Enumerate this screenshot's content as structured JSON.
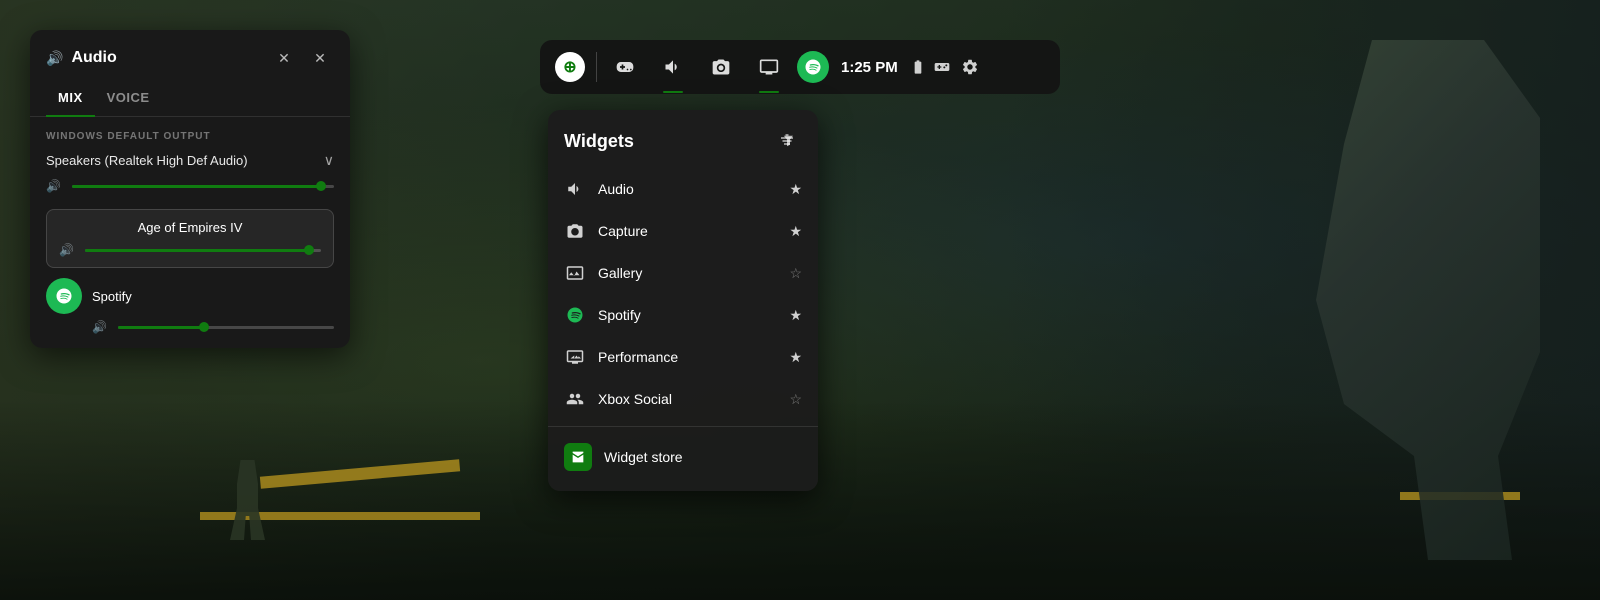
{
  "background": {
    "description": "Game scene - sci-fi military environment"
  },
  "topNav": {
    "time": "1:25 PM",
    "icons": [
      "xbox",
      "gamepad",
      "volume",
      "screenshot",
      "display",
      "spotify",
      "settings"
    ],
    "activeIcons": [
      "volume",
      "display"
    ]
  },
  "audioPanel": {
    "title": "Audio",
    "pinLabel": "✕",
    "closeLabel": "✕",
    "tabs": [
      "MIX",
      "VOICE"
    ],
    "activeTab": "MIX",
    "sectionLabel": "WINDOWS DEFAULT OUTPUT",
    "deviceName": "Speakers (Realtek High Def Audio)",
    "deviceVolume": 95,
    "appItems": [
      {
        "name": "Age of Empires IV",
        "volume": 95
      }
    ],
    "spotifyItem": {
      "name": "Spotify",
      "volume": 40
    }
  },
  "widgetsPanel": {
    "title": "Widgets",
    "items": [
      {
        "name": "Audio",
        "iconType": "volume",
        "starred": true
      },
      {
        "name": "Capture",
        "iconType": "capture",
        "starred": true
      },
      {
        "name": "Gallery",
        "iconType": "gallery",
        "starred": false
      },
      {
        "name": "Spotify",
        "iconType": "spotify",
        "starred": true
      },
      {
        "name": "Performance",
        "iconType": "performance",
        "starred": true
      },
      {
        "name": "Xbox Social",
        "iconType": "social",
        "starred": false
      }
    ],
    "storeItem": {
      "name": "Widget store",
      "iconType": "store"
    }
  }
}
